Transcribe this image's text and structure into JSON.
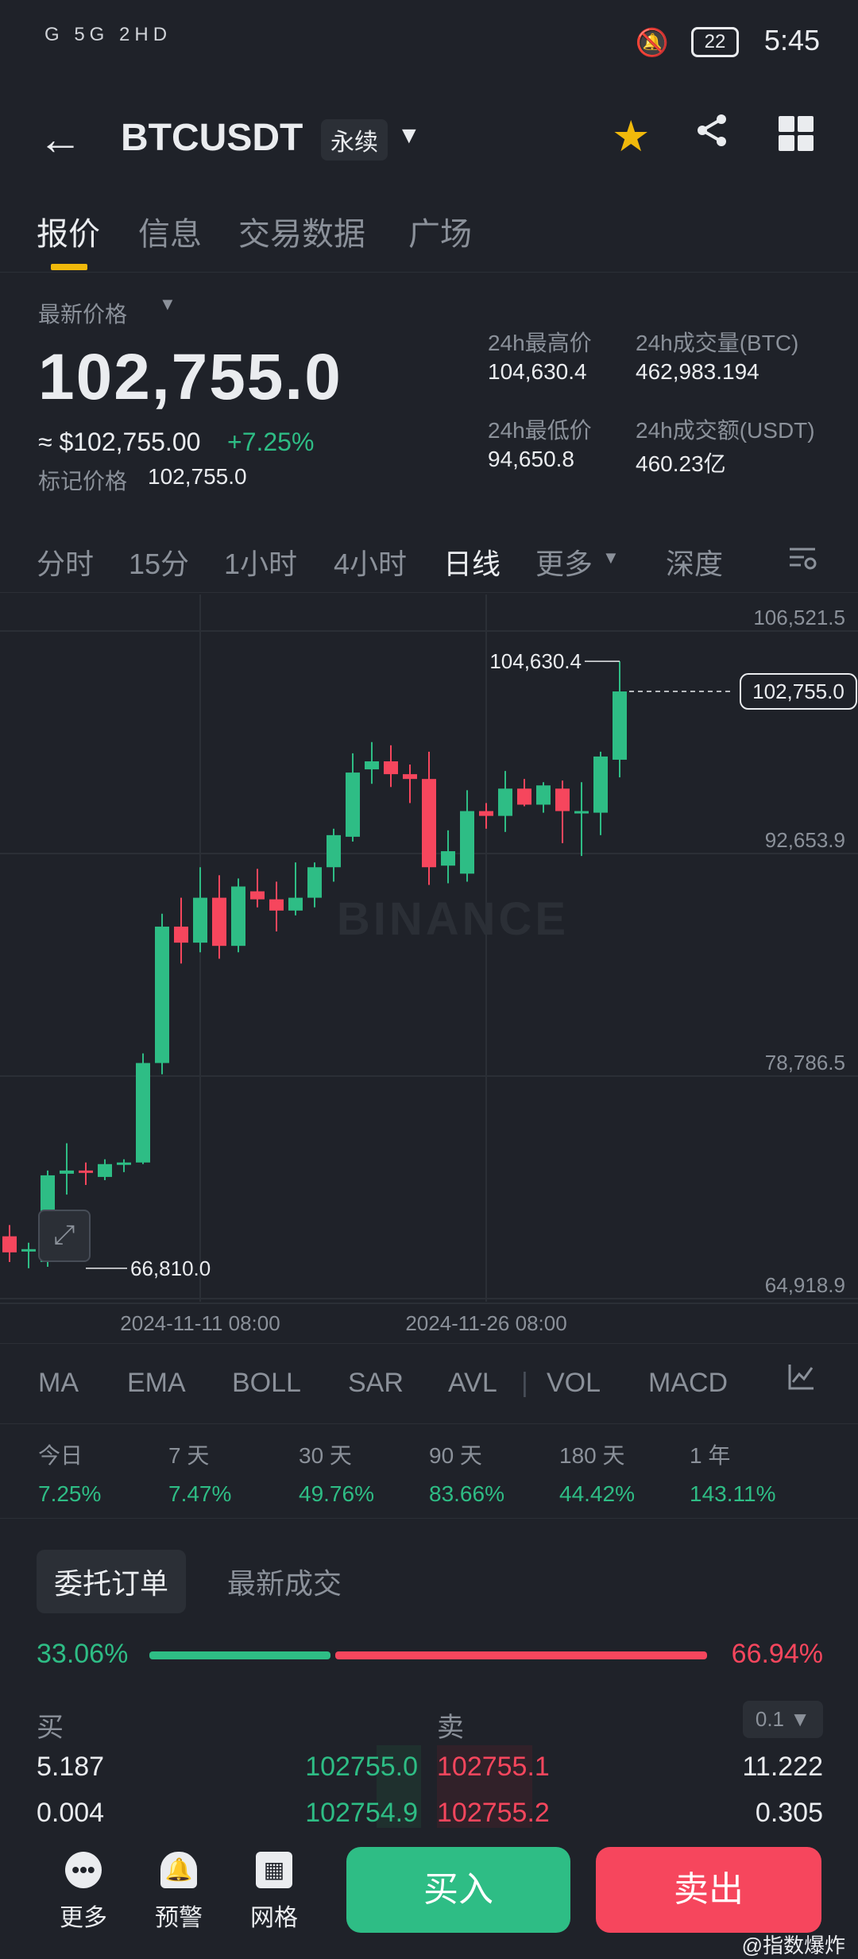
{
  "status_bar": {
    "network": "G 5G 2HD",
    "battery": "22",
    "time": "5:45"
  },
  "header": {
    "symbol": "BTCUSDT",
    "tag": "永续"
  },
  "tabs": [
    {
      "label": "报价",
      "active": true
    },
    {
      "label": "信息",
      "active": false
    },
    {
      "label": "交易数据",
      "active": false
    },
    {
      "label": "广场",
      "active": false
    }
  ],
  "price": {
    "latest_label": "最新价格",
    "latest": "102,755.0",
    "usd_approx": "≈ $102,755.00",
    "change": "+7.25%",
    "mark_label": "标记价格",
    "mark": "102,755.0"
  },
  "stats": {
    "high_label": "24h最高价",
    "high": "104,630.4",
    "vol_btc_label": "24h成交量(BTC)",
    "vol_btc": "462,983.194",
    "low_label": "24h最低价",
    "low": "94,650.8",
    "vol_usdt_label": "24h成交额(USDT)",
    "vol_usdt": "460.23亿"
  },
  "intervals": [
    {
      "label": "分时",
      "active": false
    },
    {
      "label": "15分",
      "active": false
    },
    {
      "label": "1小时",
      "active": false
    },
    {
      "label": "4小时",
      "active": false
    },
    {
      "label": "日线",
      "active": true
    },
    {
      "label": "更多",
      "active": false
    },
    {
      "label": "深度",
      "active": false
    }
  ],
  "chart_data": {
    "type": "candlestick",
    "watermark": "BINANCE",
    "y_ticks": [
      "106,521.5",
      "92,653.9",
      "78,786.5",
      "64,918.9"
    ],
    "x_ticks": [
      "2024-11-11 08:00",
      "2024-11-26 08:00"
    ],
    "ylim": [
      64918.9,
      106521.5
    ],
    "current_price_label": "102,755.0",
    "high_annotation": "104,630.4",
    "low_annotation": "66,810.0",
    "candles": [
      {
        "o": 68800,
        "h": 69500,
        "l": 67200,
        "c": 67800
      },
      {
        "o": 67900,
        "h": 68400,
        "l": 66810,
        "c": 68000
      },
      {
        "o": 67200,
        "h": 72900,
        "l": 66900,
        "c": 72600
      },
      {
        "o": 72700,
        "h": 74600,
        "l": 71400,
        "c": 72900
      },
      {
        "o": 72900,
        "h": 73400,
        "l": 72000,
        "c": 72800
      },
      {
        "o": 72500,
        "h": 73600,
        "l": 72300,
        "c": 73300
      },
      {
        "o": 73300,
        "h": 73600,
        "l": 72800,
        "c": 73400
      },
      {
        "o": 73400,
        "h": 80200,
        "l": 73300,
        "c": 79600
      },
      {
        "o": 79600,
        "h": 88900,
        "l": 78900,
        "c": 88100
      },
      {
        "o": 88100,
        "h": 89900,
        "l": 85800,
        "c": 87100
      },
      {
        "o": 87100,
        "h": 91800,
        "l": 86500,
        "c": 89900
      },
      {
        "o": 89900,
        "h": 91300,
        "l": 86100,
        "c": 86900
      },
      {
        "o": 86900,
        "h": 91100,
        "l": 86500,
        "c": 90600
      },
      {
        "o": 90300,
        "h": 91700,
        "l": 89300,
        "c": 89800
      },
      {
        "o": 89800,
        "h": 90900,
        "l": 87800,
        "c": 89100
      },
      {
        "o": 89100,
        "h": 92100,
        "l": 88800,
        "c": 89900
      },
      {
        "o": 89900,
        "h": 92100,
        "l": 89300,
        "c": 91800
      },
      {
        "o": 91800,
        "h": 94200,
        "l": 90900,
        "c": 93800
      },
      {
        "o": 93700,
        "h": 98900,
        "l": 93400,
        "c": 97700
      },
      {
        "o": 97900,
        "h": 99600,
        "l": 97000,
        "c": 98400
      },
      {
        "o": 98400,
        "h": 99400,
        "l": 96800,
        "c": 97600
      },
      {
        "o": 97600,
        "h": 98200,
        "l": 95800,
        "c": 97300
      },
      {
        "o": 97300,
        "h": 99000,
        "l": 90700,
        "c": 91800
      },
      {
        "o": 91900,
        "h": 94100,
        "l": 90800,
        "c": 92800
      },
      {
        "o": 91400,
        "h": 96600,
        "l": 90900,
        "c": 95300
      },
      {
        "o": 95300,
        "h": 95800,
        "l": 94200,
        "c": 95000
      },
      {
        "o": 95000,
        "h": 97800,
        "l": 94000,
        "c": 96700
      },
      {
        "o": 96700,
        "h": 97300,
        "l": 95600,
        "c": 95700
      },
      {
        "o": 95700,
        "h": 97100,
        "l": 95200,
        "c": 96900
      },
      {
        "o": 96700,
        "h": 97200,
        "l": 93300,
        "c": 95300
      },
      {
        "o": 95300,
        "h": 97100,
        "l": 92500,
        "c": 95300
      },
      {
        "o": 95200,
        "h": 99000,
        "l": 93800,
        "c": 98700
      },
      {
        "o": 98500,
        "h": 104630.4,
        "l": 97400,
        "c": 102755.0
      }
    ]
  },
  "indicators": [
    "MA",
    "EMA",
    "BOLL",
    "SAR",
    "AVL",
    "VOL",
    "MACD"
  ],
  "performance": [
    {
      "label": "今日",
      "value": "7.25%"
    },
    {
      "label": "7 天",
      "value": "7.47%"
    },
    {
      "label": "30 天",
      "value": "49.76%"
    },
    {
      "label": "90 天",
      "value": "83.66%"
    },
    {
      "label": "180 天",
      "value": "44.42%"
    },
    {
      "label": "1 年",
      "value": "143.11%"
    }
  ],
  "orderbook": {
    "tab_active": "委托订单",
    "tab_other": "最新成交",
    "buy_ratio": "33.06%",
    "sell_ratio": "66.94%",
    "buy_label": "买",
    "sell_label": "卖",
    "precision": "0.1",
    "rows": [
      {
        "bid_qty": "5.187",
        "bid_price": "102755.0",
        "ask_price": "102755.1",
        "ask_qty": "11.222"
      },
      {
        "bid_qty": "0.004",
        "bid_price": "102754.9",
        "ask_price": "102755.2",
        "ask_qty": "0.305"
      }
    ]
  },
  "bottom": {
    "more": "更多",
    "alert": "预警",
    "grid": "网格",
    "buy": "买入",
    "sell": "卖出",
    "watermark": "@指数爆炸"
  }
}
